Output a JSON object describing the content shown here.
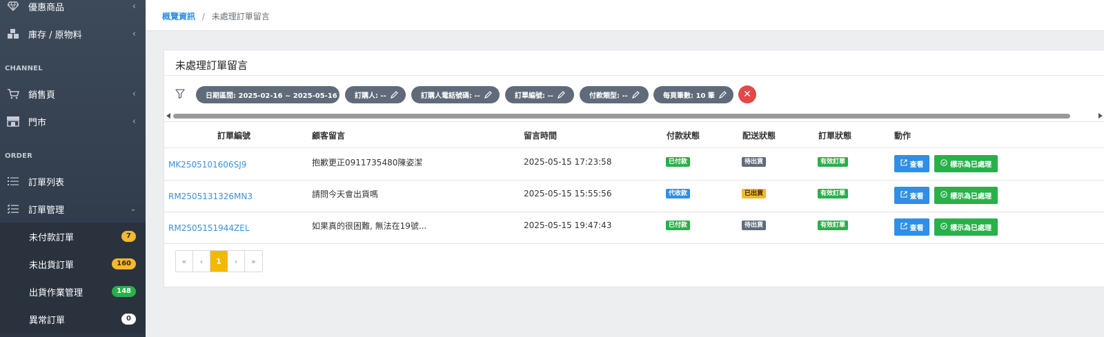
{
  "sidebar": {
    "items_top": [
      {
        "label": "優惠商品",
        "icon": "diamond-icon"
      },
      {
        "label": "庫存 / 原物料",
        "icon": "boxes-icon"
      }
    ],
    "section_channel": "CHANNEL",
    "channel_items": [
      {
        "label": "銷售頁",
        "icon": "cart-icon"
      },
      {
        "label": "門市",
        "icon": "store-icon"
      }
    ],
    "section_order": "ORDER",
    "order_items": [
      {
        "label": "訂單列表",
        "icon": "list-icon"
      },
      {
        "label": "訂單管理",
        "icon": "checklist-icon"
      }
    ],
    "sub_items": [
      {
        "label": "未付款訂單",
        "count": "7",
        "color": "#f5b82e"
      },
      {
        "label": "未出貨訂單",
        "count": "160",
        "color": "#f5b82e"
      },
      {
        "label": "出貨作業管理",
        "count": "148",
        "color": "#28b04a"
      },
      {
        "label": "異常訂單",
        "count": "0",
        "color": "#ffffff"
      }
    ]
  },
  "breadcrumb": {
    "home": "概覽資訊",
    "separator": "/",
    "current": "未處理訂單留言"
  },
  "card": {
    "title": "未處理訂單留言",
    "filters": [
      "日期區間: 2025-02-16 ~ 2025-05-16",
      "訂購人: --",
      "訂購人電話號碼: --",
      "訂單編號: --",
      "付款類型: --",
      "每頁筆數: 10 筆"
    ],
    "clear_symbol": "✕"
  },
  "table": {
    "headers": [
      "訂單編號",
      "顧客留言",
      "留言時間",
      "付款狀態",
      "配送狀態",
      "訂單狀態",
      "動作"
    ],
    "rows": [
      {
        "order_no": "MK2505101606SJ9",
        "message": "抱歉更正0911735480陳姿潔",
        "time": "2025-05-15 17:23:58",
        "payment": "已付款",
        "payment_color": "#28b04a",
        "shipping": "待出貨",
        "shipping_color": "#5f6b7a",
        "status": "有效訂單"
      },
      {
        "order_no": "RM2505131326MN3",
        "message": "請問今天會出貨嗎",
        "time": "2025-05-15 15:55:56",
        "payment": "代收款",
        "payment_color": "#2f8ee5",
        "shipping": "已出貨",
        "shipping_color": "#f5b82e",
        "status": "有效訂單"
      },
      {
        "order_no": "RM2505151944ZEL",
        "message": "如果真的很困難, 無法在19號...",
        "time": "2025-05-15 19:47:43",
        "payment": "已付款",
        "payment_color": "#28b04a",
        "shipping": "待出貨",
        "shipping_color": "#5f6b7a",
        "status": "有效訂單"
      }
    ],
    "view_label": "查看",
    "done_label": "標示為已處理"
  },
  "pagination": {
    "first": "«",
    "prev": "‹",
    "current": "1",
    "next": "›",
    "last": "»"
  }
}
